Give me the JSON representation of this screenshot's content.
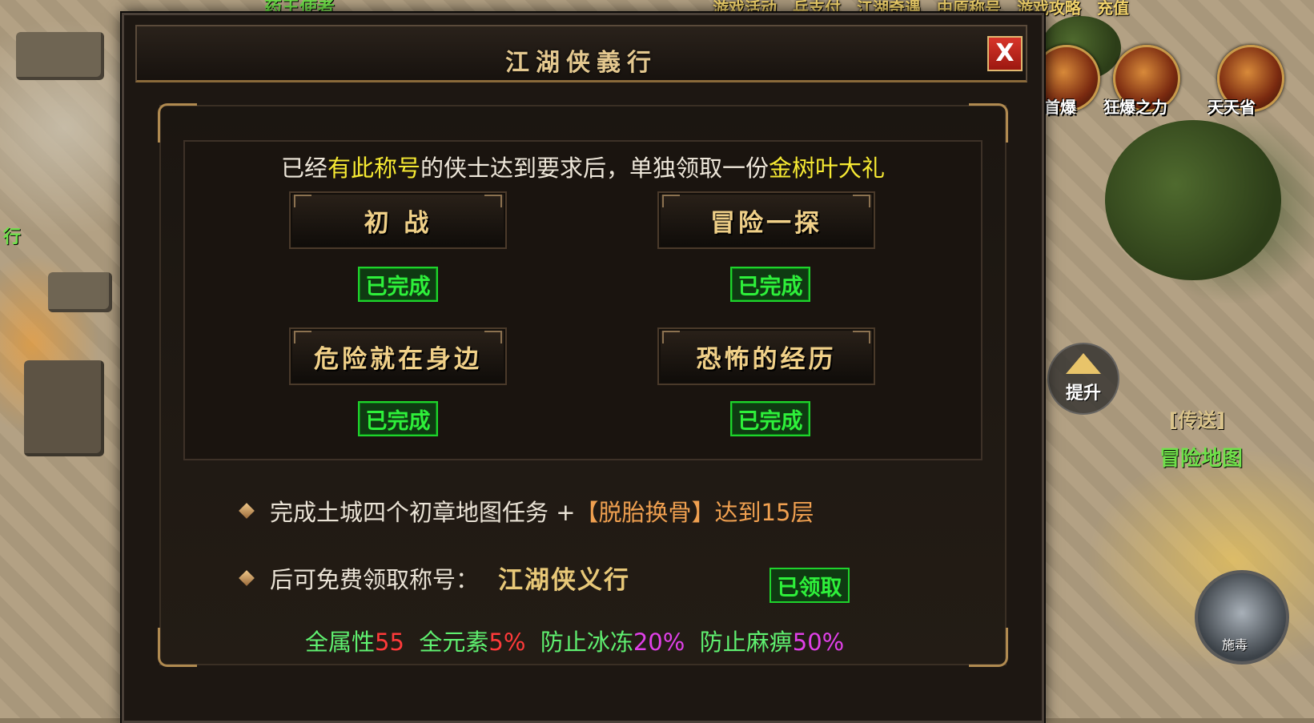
{
  "background": {
    "top_left_label": "药王使者",
    "side_left_label": "行",
    "top_menu": [
      "游戏活动",
      "兵支付",
      "江湖奇遇",
      "中原称号",
      "游戏攻略",
      "充值"
    ],
    "round_icons": [
      {
        "label": "首爆",
        "icon": "first-drop-icon"
      },
      {
        "label": "狂爆之力",
        "icon": "rage-power-icon"
      },
      {
        "label": "天天省",
        "icon": "daily-save-icon"
      }
    ],
    "upgrade_label": "提升",
    "teleport_label": "[传送]",
    "teleport_map": "冒险地图",
    "skill_label": "施毒"
  },
  "dialog": {
    "title": "江湖侠義行",
    "close_label": "X",
    "intro": {
      "part1": "已经",
      "highlight1": "有此称号",
      "part2": "的侠士达到要求后，单独领取一份",
      "highlight2": "金树叶大礼"
    },
    "quests": [
      {
        "name": "初 战",
        "status": "已完成"
      },
      {
        "name": "冒险一探",
        "status": "已完成"
      },
      {
        "name": "危险就在身边",
        "status": "已完成"
      },
      {
        "name": "恐怖的经历",
        "status": "已完成"
      }
    ],
    "requirement": {
      "prefix": "完成土城四个初章地图任务 + ",
      "highlight": "【脱胎换骨】",
      "suffix": "达到15层"
    },
    "reward": {
      "prefix": "后可免费领取称号：",
      "title_name": "江湖侠义行",
      "claimed_label": "已领取"
    },
    "stats": [
      {
        "label": "全属性",
        "value": "55",
        "color": "#ff3a3a"
      },
      {
        "label": "全元素",
        "value": "5%",
        "color": "#ff3a3a"
      },
      {
        "label": "防止冰冻",
        "value": "20%",
        "color": "#e040e8"
      },
      {
        "label": "防止麻痹",
        "value": "50%",
        "color": "#e040e8"
      }
    ]
  }
}
